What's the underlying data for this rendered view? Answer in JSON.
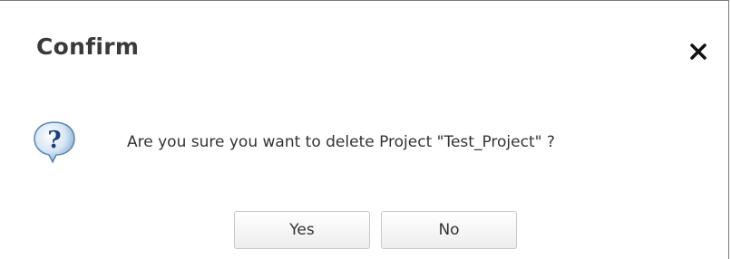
{
  "dialog": {
    "title": "Confirm",
    "message": "Are you sure you want to delete Project \"Test_Project\" ?",
    "icon": "question-icon",
    "close_icon": "close-icon",
    "buttons": {
      "yes_label": "Yes",
      "no_label": "No"
    }
  }
}
